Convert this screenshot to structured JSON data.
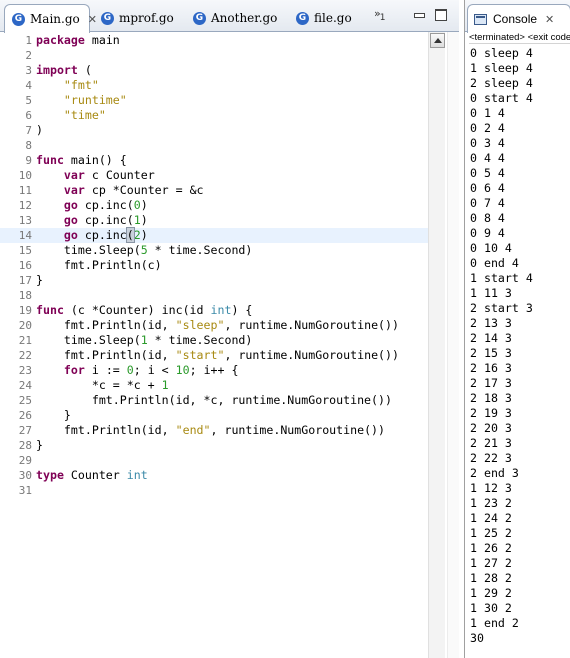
{
  "editor": {
    "tabs": [
      {
        "label": "Main.go",
        "icon": "go-file-icon",
        "active": true,
        "close": "✕"
      },
      {
        "label": "mprof.go",
        "icon": "go-file-icon",
        "active": false
      },
      {
        "label": "Another.go",
        "icon": "go-file-icon",
        "active": false
      },
      {
        "label": "file.go",
        "icon": "go-file-icon",
        "active": false
      }
    ],
    "overflow_label": "»",
    "overflow_count": "1",
    "current_line": 14,
    "lines": [
      [
        {
          "c": "kw",
          "t": "package"
        },
        {
          "t": " main"
        }
      ],
      [],
      [
        {
          "c": "kw",
          "t": "import"
        },
        {
          "t": " ("
        }
      ],
      [
        {
          "t": "    "
        },
        {
          "c": "str",
          "t": "\"fmt\""
        }
      ],
      [
        {
          "t": "    "
        },
        {
          "c": "str",
          "t": "\"runtime\""
        }
      ],
      [
        {
          "t": "    "
        },
        {
          "c": "str",
          "t": "\"time\""
        }
      ],
      [
        {
          "t": ")"
        }
      ],
      [],
      [
        {
          "c": "kw",
          "t": "func"
        },
        {
          "t": " main() {"
        }
      ],
      [
        {
          "t": "    "
        },
        {
          "c": "kw",
          "t": "var"
        },
        {
          "t": " c Counter"
        }
      ],
      [
        {
          "t": "    "
        },
        {
          "c": "kw",
          "t": "var"
        },
        {
          "t": " cp *Counter = &c"
        }
      ],
      [
        {
          "t": "    "
        },
        {
          "c": "kw",
          "t": "go"
        },
        {
          "t": " cp.inc("
        },
        {
          "c": "num",
          "t": "0"
        },
        {
          "t": ")"
        }
      ],
      [
        {
          "t": "    "
        },
        {
          "c": "kw",
          "t": "go"
        },
        {
          "t": " cp.inc("
        },
        {
          "c": "num",
          "t": "1"
        },
        {
          "t": ")"
        }
      ],
      [
        {
          "t": "    "
        },
        {
          "c": "kw",
          "t": "go"
        },
        {
          "t": " cp.inc"
        },
        {
          "c": "paren",
          "t": "("
        },
        {
          "c": "num",
          "t": "2"
        },
        {
          "t": ")"
        }
      ],
      [
        {
          "t": "    time.Sleep("
        },
        {
          "c": "num",
          "t": "5"
        },
        {
          "t": " * time.Second)"
        }
      ],
      [
        {
          "t": "    fmt.Println(c)"
        }
      ],
      [
        {
          "t": "}"
        }
      ],
      [],
      [
        {
          "c": "kw",
          "t": "func"
        },
        {
          "t": " (c *Counter) inc(id "
        },
        {
          "c": "typ",
          "t": "int"
        },
        {
          "t": ") {"
        }
      ],
      [
        {
          "t": "    fmt.Println(id, "
        },
        {
          "c": "str",
          "t": "\"sleep\""
        },
        {
          "t": ", runtime.NumGoroutine())"
        }
      ],
      [
        {
          "t": "    time.Sleep("
        },
        {
          "c": "num",
          "t": "1"
        },
        {
          "t": " * time.Second)"
        }
      ],
      [
        {
          "t": "    fmt.Println(id, "
        },
        {
          "c": "str",
          "t": "\"start\""
        },
        {
          "t": ", runtime.NumGoroutine())"
        }
      ],
      [
        {
          "t": "    "
        },
        {
          "c": "kw",
          "t": "for"
        },
        {
          "t": " i := "
        },
        {
          "c": "num",
          "t": "0"
        },
        {
          "t": "; i < "
        },
        {
          "c": "num",
          "t": "10"
        },
        {
          "t": "; i++ {"
        }
      ],
      [
        {
          "t": "        *c = *c + "
        },
        {
          "c": "num",
          "t": "1"
        }
      ],
      [
        {
          "t": "        fmt.Println(id, *c, runtime.NumGoroutine())"
        }
      ],
      [
        {
          "t": "    }"
        }
      ],
      [
        {
          "t": "    fmt.Println(id, "
        },
        {
          "c": "str",
          "t": "\"end\""
        },
        {
          "t": ", runtime.NumGoroutine())"
        }
      ],
      [
        {
          "t": "}"
        }
      ],
      [],
      [
        {
          "c": "kw",
          "t": "type"
        },
        {
          "t": " Counter "
        },
        {
          "c": "typ",
          "t": "int"
        }
      ],
      []
    ]
  },
  "console": {
    "title": "Console",
    "close": "✕",
    "status": "<terminated> <exit code",
    "output": [
      "0 sleep 4",
      "1 sleep 4",
      "2 sleep 4",
      "0 start 4",
      "0 1 4",
      "0 2 4",
      "0 3 4",
      "0 4 4",
      "0 5 4",
      "0 6 4",
      "0 7 4",
      "0 8 4",
      "0 9 4",
      "0 10 4",
      "0 end 4",
      "1 start 4",
      "1 11 3",
      "2 start 3",
      "2 13 3",
      "2 14 3",
      "2 15 3",
      "2 16 3",
      "2 17 3",
      "2 18 3",
      "2 19 3",
      "2 20 3",
      "2 21 3",
      "2 22 3",
      "2 end 3",
      "1 12 3",
      "1 23 2",
      "1 24 2",
      "1 25 2",
      "1 26 2",
      "1 27 2",
      "1 28 2",
      "1 29 2",
      "1 30 2",
      "1 end 2",
      "30"
    ]
  },
  "colors": {
    "keyword": "#7f0055",
    "string": "#a88a12",
    "number": "#2a9a2a",
    "type": "#3b8aa8",
    "current_line": "#e8f2fe",
    "go_icon": "#2d67c6"
  }
}
